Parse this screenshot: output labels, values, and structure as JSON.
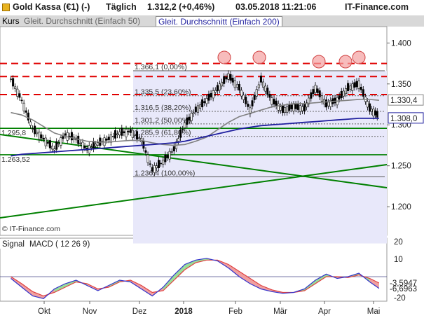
{
  "header": {
    "instrument": "Gold Kassa (€1) (-)",
    "interval": "Täglich",
    "quote": "1.312,2 (+0,46%)",
    "datetime": "03.05.2018 11:21:06",
    "brand": "IT-Finance.com"
  },
  "tabs": {
    "kurs": "Kurs",
    "sma50": "Gleit. Durchschnitt (Einfach 50)",
    "sma200": "Gleit. Durchschnitt (Einfach 200)"
  },
  "colors": {
    "price": "#000000",
    "sma50": "#808080",
    "sma200": "#1f1f9e",
    "resistance": "#e00000",
    "trend": "#008000",
    "highlight": "#e8e8fa",
    "macd": "#3333cc",
    "signal": "#e04040"
  },
  "chart_data": [
    {
      "type": "line",
      "title": "Gold Kassa (€1) Täglich",
      "ylim": [
        1.165,
        1.42
      ],
      "y_ticks": [
        "1.400",
        "1.350",
        "1.300",
        "1.250",
        "1.200"
      ],
      "y_tick_values": [
        1.4,
        1.35,
        1.3,
        1.25,
        1.2
      ],
      "x_ticks": [
        "Okt",
        "Nov",
        "Dez",
        "2018",
        "Feb",
        "Mär",
        "Apr",
        "Mai"
      ],
      "dates": [
        "2017-09-08",
        "2017-09-15",
        "2017-09-22",
        "2017-09-29",
        "2017-10-06",
        "2017-10-13",
        "2017-10-20",
        "2017-10-27",
        "2017-11-03",
        "2017-11-10",
        "2017-11-17",
        "2017-11-24",
        "2017-12-01",
        "2017-12-08",
        "2017-12-15",
        "2017-12-22",
        "2017-12-29",
        "2018-01-05",
        "2018-01-12",
        "2018-01-19",
        "2018-01-26",
        "2018-02-02",
        "2018-02-09",
        "2018-02-16",
        "2018-02-23",
        "2018-03-02",
        "2018-03-09",
        "2018-03-16",
        "2018-03-23",
        "2018-03-30",
        "2018-04-06",
        "2018-04-13",
        "2018-04-20",
        "2018-04-27",
        "2018-05-03"
      ],
      "series": [
        {
          "name": "Kurs",
          "values": [
            1.356,
            1.33,
            1.295,
            1.283,
            1.27,
            1.288,
            1.283,
            1.27,
            1.277,
            1.283,
            1.29,
            1.292,
            1.282,
            1.245,
            1.255,
            1.27,
            1.3,
            1.318,
            1.33,
            1.344,
            1.36,
            1.345,
            1.318,
            1.355,
            1.33,
            1.318,
            1.322,
            1.32,
            1.345,
            1.325,
            1.33,
            1.345,
            1.35,
            1.32,
            1.31
          ]
        },
        {
          "name": "Gleit. Durchschnitt (Einfach 50)",
          "values": [
            1.315,
            1.312,
            1.306,
            1.298,
            1.29,
            1.286,
            1.283,
            1.28,
            1.279,
            1.279,
            1.28,
            1.281,
            1.281,
            1.278,
            1.276,
            1.275,
            1.276,
            1.28,
            1.285,
            1.294,
            1.303,
            1.31,
            1.314,
            1.318,
            1.322,
            1.324,
            1.326,
            1.326,
            1.327,
            1.328,
            1.329,
            1.33,
            1.331,
            1.331,
            1.33
          ]
        },
        {
          "name": "Gleit. Durchschnitt (Einfach 200)",
          "values": [
            1.262,
            1.264,
            1.265,
            1.266,
            1.267,
            1.268,
            1.269,
            1.27,
            1.271,
            1.272,
            1.273,
            1.274,
            1.275,
            1.276,
            1.277,
            1.278,
            1.28,
            1.283,
            1.286,
            1.289,
            1.292,
            1.295,
            1.297,
            1.299,
            1.3,
            1.301,
            1.302,
            1.303,
            1.304,
            1.305,
            1.306,
            1.307,
            1.308,
            1.308,
            1.308
          ]
        }
      ],
      "last_labels": {
        "sma50": "1.330,4",
        "sma200": "1.308,0"
      },
      "resistance_levels": [
        1.375,
        1.359,
        1.337
      ],
      "fibonacci": [
        {
          "label": "1.366,1 (0,00%)",
          "value": 1.3661
        },
        {
          "label": "1.335,5 (23,60%)",
          "value": 1.3355
        },
        {
          "label": "1.316,5 (38,20%)",
          "value": 1.3165
        },
        {
          "label": "1.301,2 (50,00%)",
          "value": 1.3012
        },
        {
          "label": "1.285,9 (61,80%)",
          "value": 1.2859
        },
        {
          "label": "1.236,4 (100,00%)",
          "value": 1.2364
        }
      ],
      "horizontal_levels": [
        {
          "label": "1.295,8",
          "value": 1.2958
        },
        {
          "label": "1.263,52",
          "value": 1.2635
        }
      ],
      "watermark": "© IT-Finance.com",
      "grid": false
    },
    {
      "type": "line",
      "title": "Signal MACD (12 26 9)",
      "ylim": [
        -14,
        22
      ],
      "y_ticks": [
        "20",
        "10",
        "-20"
      ],
      "y_tick_values": [
        20,
        10,
        -20
      ],
      "series": [
        {
          "name": "MACD",
          "values": [
            -1,
            -6,
            -11,
            -12.5,
            -7,
            -4,
            -2,
            -5,
            -8,
            -5,
            -2,
            -3,
            -7,
            -11,
            -6,
            1,
            7,
            9.5,
            10.5,
            9,
            5,
            0,
            -4,
            -7,
            -8.5,
            -9.5,
            -9,
            -7,
            -2,
            1.5,
            -1,
            0,
            2,
            -3,
            -6.7
          ]
        },
        {
          "name": "Signal",
          "values": [
            0,
            -4,
            -8.5,
            -11,
            -9,
            -6,
            -3,
            -4,
            -7,
            -6,
            -3,
            -2,
            -5,
            -9,
            -8,
            -2,
            4,
            8,
            9.5,
            9.5,
            7,
            3,
            -1,
            -5,
            -7.5,
            -9,
            -9,
            -8,
            -4,
            0,
            0,
            -0.5,
            1,
            -1,
            -3.6
          ]
        }
      ],
      "last_labels": {
        "signal": "-3,5947",
        "macd": "-6,6963"
      }
    }
  ]
}
